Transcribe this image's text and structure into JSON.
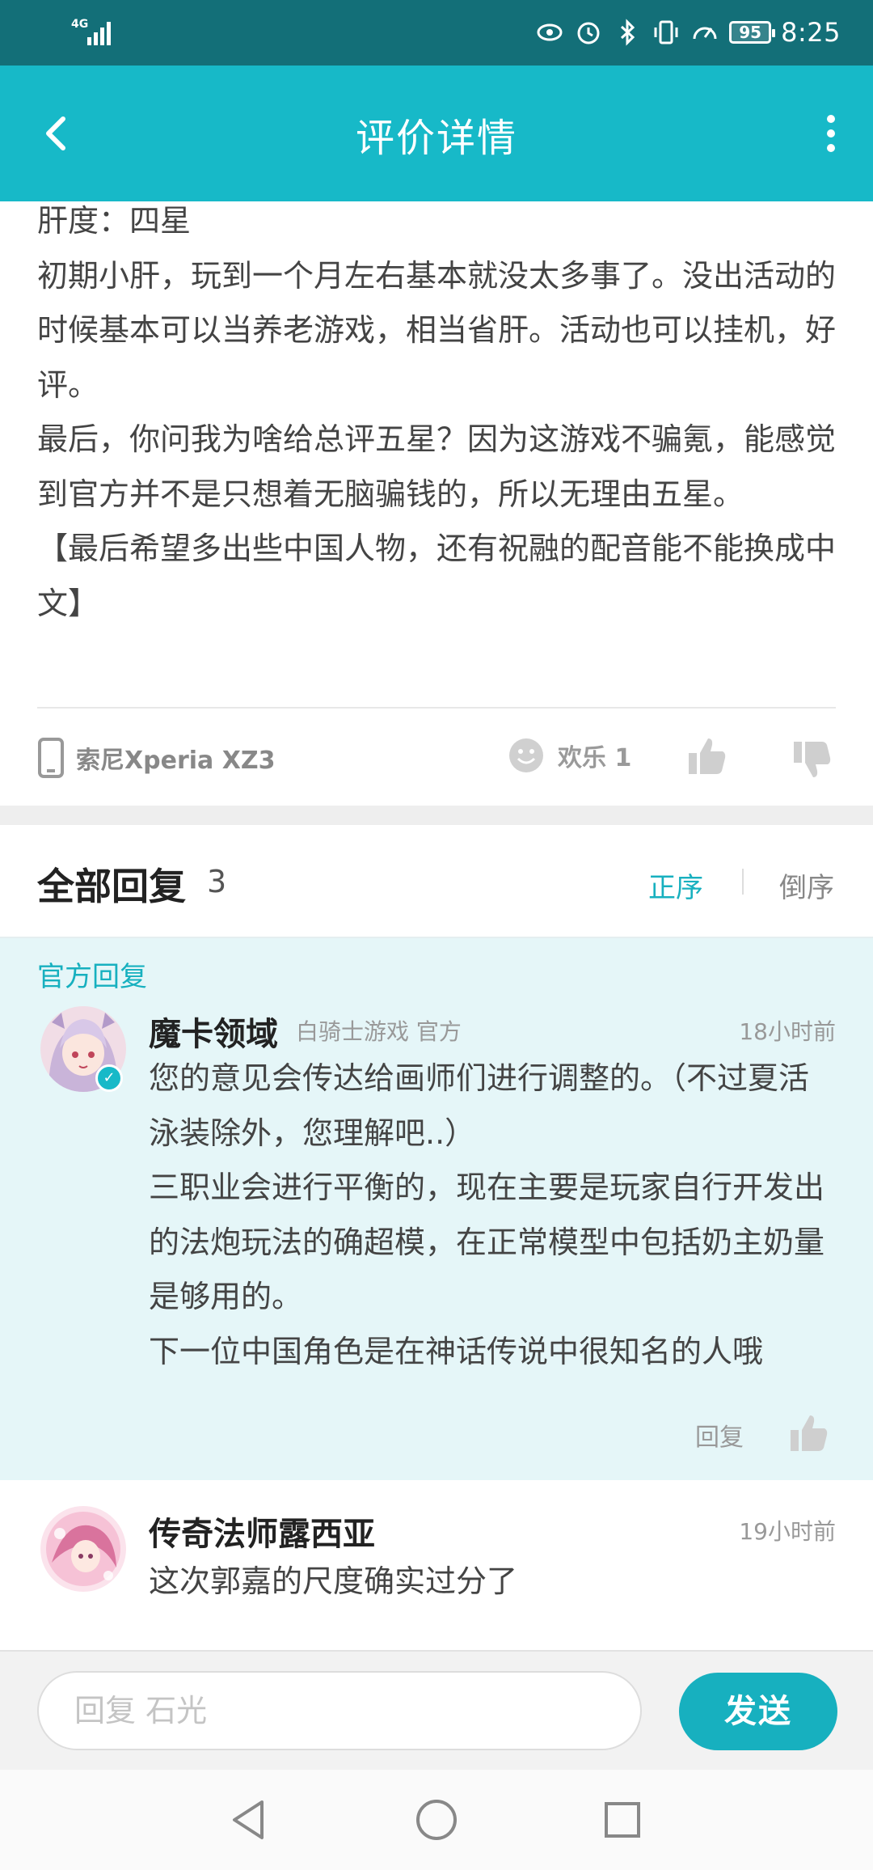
{
  "status_bar": {
    "network": "4G",
    "battery": "95",
    "time": "8:25",
    "icons": [
      "eye-icon",
      "alarm-icon",
      "bluetooth-icon",
      "vibrate-icon",
      "speed-icon"
    ]
  },
  "header": {
    "title": "评价详情",
    "back_icon": "chevron-left-icon",
    "more_icon": "more-vertical-icon"
  },
  "review": {
    "paragraphs": [
      "肝度：四星",
      "初期小肝，玩到一个月左右基本就没太多事了。没出活动的时候基本可以当养老游戏，相当省肝。活动也可以挂机，好评。",
      "最后，你问我为啥给总评五星？因为这游戏不骗氪，能感觉到官方并不是只想着无脑骗钱的，所以无理由五星。",
      "【最后希望多出些中国人物，还有祝融的配音能不能换成中文】"
    ],
    "device": "索尼Xperia XZ3",
    "reaction_label": "欢乐 1"
  },
  "replies": {
    "title": "全部回复",
    "count": "3",
    "sort_asc": "正序",
    "sort_desc": "倒序",
    "official_tag": "官方回复",
    "items": [
      {
        "username": "魔卡领域",
        "sub": "白骑士游戏 官方",
        "time": "18小时前",
        "paragraphs": [
          "您的意见会传达给画师们进行调整的。（不过夏活泳装除外，您理解吧..）",
          "三职业会进行平衡的，现在主要是玩家自行开发出的法炮玩法的确超模，在正常模型中包括奶主奶量是够用的。",
          "下一位中国角色是在神话传说中很知名的人哦"
        ],
        "reply_label": "回复"
      },
      {
        "username": "传奇法师露西亚",
        "time": "19小时前",
        "text": "这次郭嘉的尺度确实过分了"
      }
    ]
  },
  "input": {
    "placeholder": "回复 石光",
    "send_label": "发送"
  },
  "colors": {
    "status_bar": "#136f78",
    "header": "#17b9c8",
    "accent": "#17b0bf",
    "official_bg": "#e5f6f8"
  }
}
